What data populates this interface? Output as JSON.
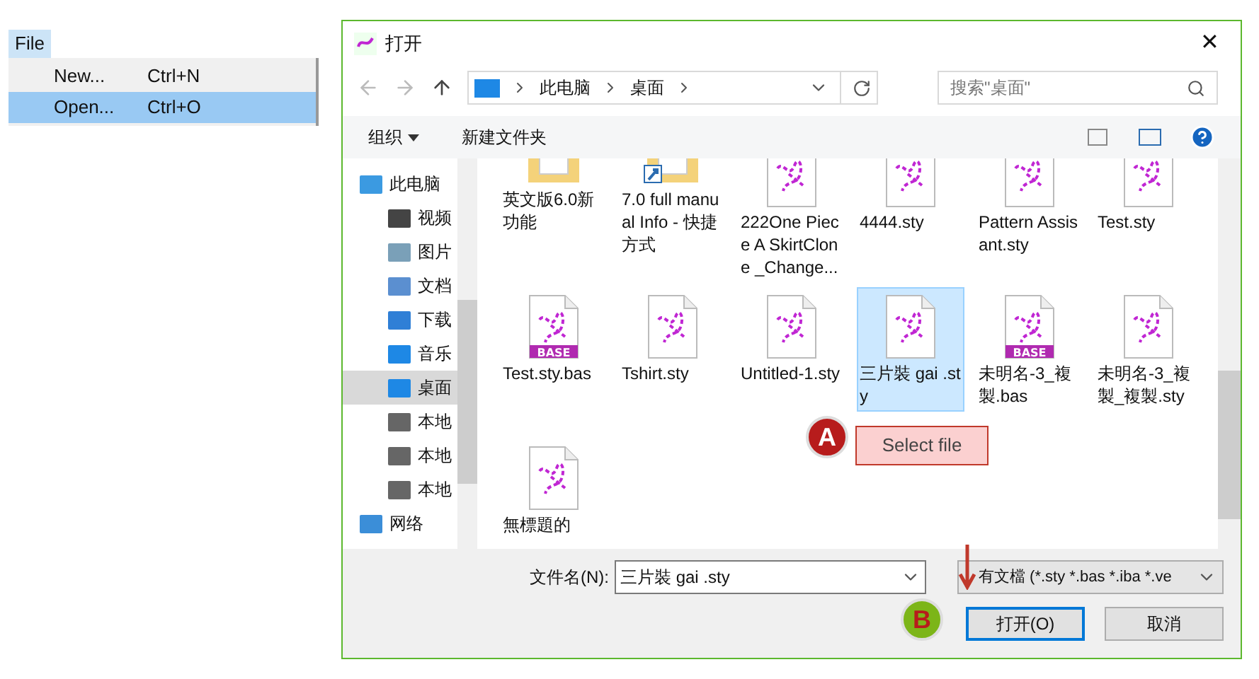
{
  "menu_bar": {
    "label": "File",
    "items": [
      {
        "label": "New...",
        "shortcut": "Ctrl+N",
        "selected": false
      },
      {
        "label": "Open...",
        "shortcut": "Ctrl+O",
        "selected": true
      }
    ]
  },
  "dialog": {
    "title": "打开",
    "close": "✕",
    "breadcrumb": [
      "此电脑",
      "桌面"
    ],
    "search": {
      "placeholder": "搜索\"桌面\""
    },
    "toolbar": {
      "organize": "组织",
      "new_folder": "新建文件夹"
    },
    "nav": [
      {
        "label": "此电脑",
        "kind": "pc",
        "selected": false
      },
      {
        "label": "视频",
        "kind": "video",
        "selected": false
      },
      {
        "label": "图片",
        "kind": "picture",
        "selected": false
      },
      {
        "label": "文档",
        "kind": "document",
        "selected": false
      },
      {
        "label": "下载",
        "kind": "download",
        "selected": false
      },
      {
        "label": "音乐",
        "kind": "music",
        "selected": false
      },
      {
        "label": "桌面",
        "kind": "desktop",
        "selected": true
      },
      {
        "label": "本地",
        "kind": "drive",
        "selected": false
      },
      {
        "label": "本地",
        "kind": "drive",
        "selected": false
      },
      {
        "label": "本地",
        "kind": "drive",
        "selected": false
      },
      {
        "label": "网络",
        "kind": "network",
        "selected": false
      }
    ],
    "files": [
      {
        "name": "英文版6.0新功能",
        "kind": "folder",
        "selected": false
      },
      {
        "name": "7.0 full manual Info - 快捷方式",
        "kind": "shortcut",
        "selected": false
      },
      {
        "name": "222One Piece A SkirtClone _Change...",
        "kind": "sty",
        "selected": false
      },
      {
        "name": "4444.sty",
        "kind": "sty",
        "selected": false
      },
      {
        "name": "Pattern Assisant.sty",
        "kind": "sty",
        "selected": false
      },
      {
        "name": "Test.sty",
        "kind": "sty",
        "selected": false
      },
      {
        "name": "Test.sty.bas",
        "kind": "base",
        "badge": "BASE",
        "selected": false
      },
      {
        "name": "Tshirt.sty",
        "kind": "sty",
        "selected": false
      },
      {
        "name": "Untitled-1.sty",
        "kind": "sty",
        "selected": false
      },
      {
        "name": "三片裝 gai .sty",
        "kind": "sty",
        "selected": true
      },
      {
        "name": "未明名-3_複製.bas",
        "kind": "base",
        "badge": "BASE",
        "selected": false
      },
      {
        "name": "未明名-3_複製_複製.sty",
        "kind": "sty",
        "selected": false
      },
      {
        "name": "無標題的",
        "kind": "sty",
        "selected": false
      }
    ],
    "filename_label": "文件名(N):",
    "filename": "三片裝 gai .sty",
    "filter": "有文檔 (*.sty *.bas *.iba *.ve",
    "buttons": [
      {
        "label": "打开(O)",
        "selected": true
      },
      {
        "label": "取消",
        "selected": false
      }
    ]
  },
  "callouts": [
    {
      "letter": "A",
      "text": "Select file"
    },
    {
      "letter": "B"
    }
  ]
}
